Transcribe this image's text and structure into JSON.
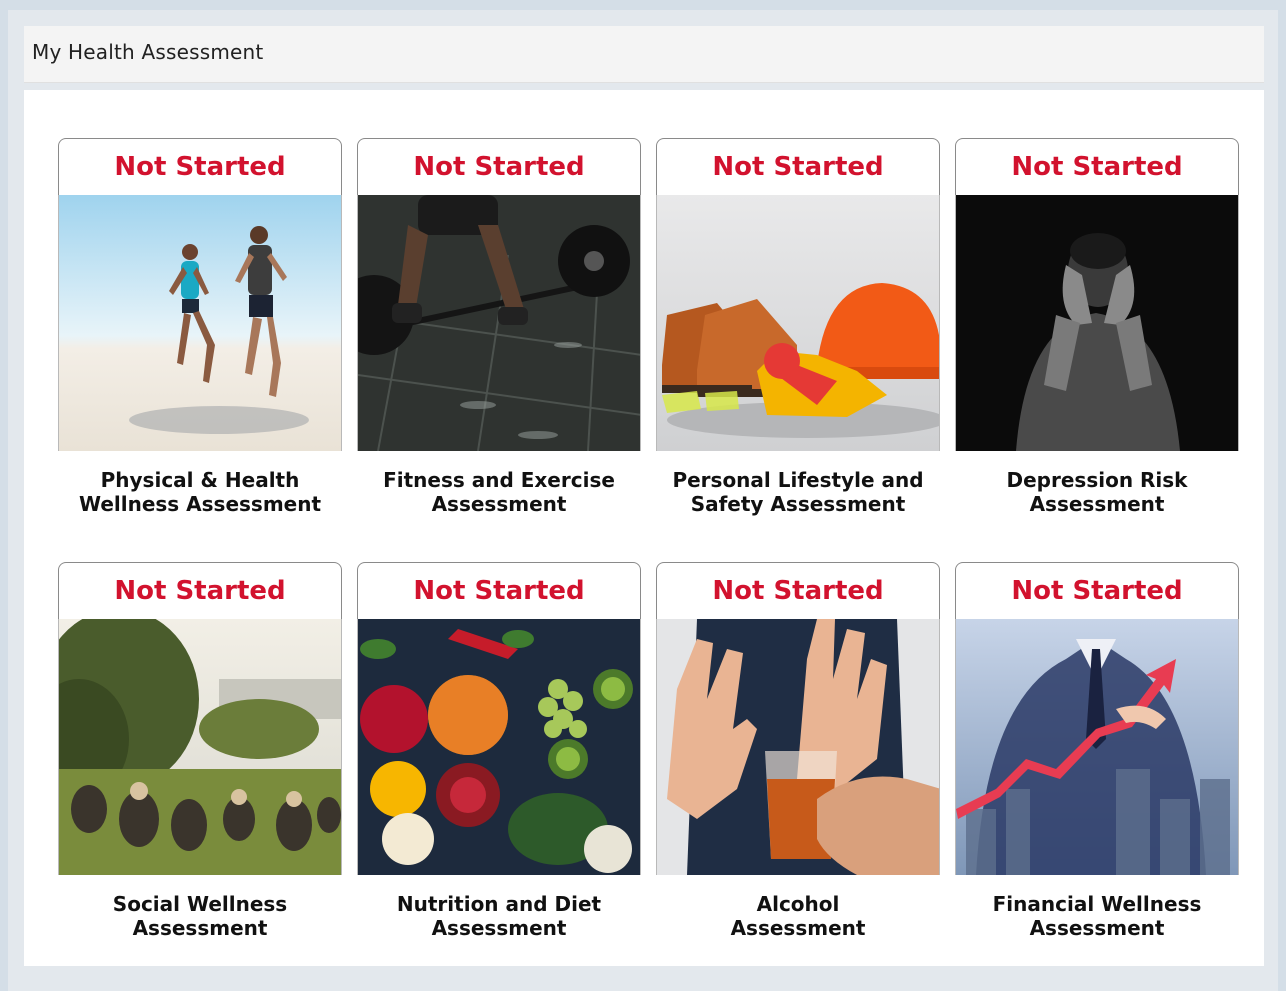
{
  "header": {
    "title": "My Health Assessment"
  },
  "assessments": [
    {
      "status": "Not Started",
      "title_line1": "Physical & Health",
      "title_line2": "Wellness Assessment",
      "image": "runners-on-beach"
    },
    {
      "status": "Not Started",
      "title_line1": "Fitness and Exercise",
      "title_line2": "Assessment",
      "image": "barbell-deadlift"
    },
    {
      "status": "Not Started",
      "title_line1": "Personal Lifestyle and",
      "title_line2": "Safety Assessment",
      "image": "safety-gear"
    },
    {
      "status": "Not Started",
      "title_line1": "Depression Risk",
      "title_line2": "Assessment",
      "image": "man-covering-face"
    },
    {
      "status": "Not Started",
      "title_line1": "Social Wellness",
      "title_line2": "Assessment",
      "image": "people-in-park"
    },
    {
      "status": "Not Started",
      "title_line1": "Nutrition and Diet",
      "title_line2": "Assessment",
      "image": "fruits-and-vegetables"
    },
    {
      "status": "Not Started",
      "title_line1": "Alcohol",
      "title_line2": "Assessment",
      "image": "refusing-alcohol"
    },
    {
      "status": "Not Started",
      "title_line1": "Financial Wellness",
      "title_line2": "Assessment",
      "image": "businessman-growth-chart"
    }
  ],
  "colors": {
    "status_red": "#d2122e",
    "page_background": "#d4dee7"
  }
}
